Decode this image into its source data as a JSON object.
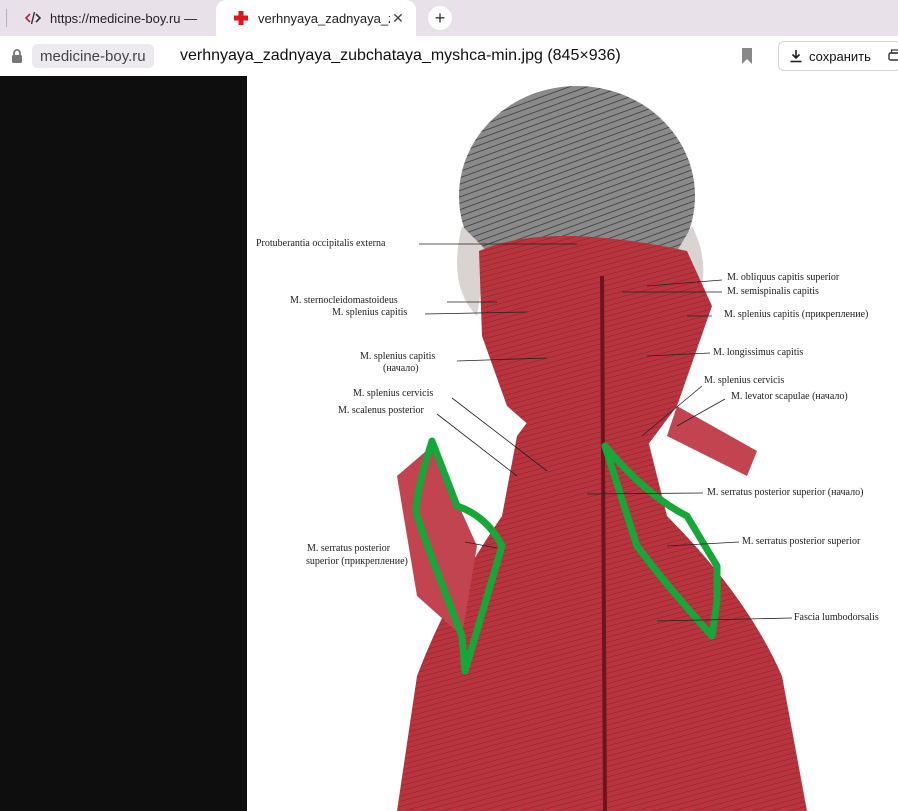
{
  "tabs": [
    {
      "title": "https://medicine-boy.ru —",
      "active": false,
      "favicon": "code-icon"
    },
    {
      "title": "verhnyaya_zadnyaya_zu",
      "active": true,
      "favicon": "red-cross-icon"
    }
  ],
  "address": {
    "domain": "medicine-boy.ru",
    "page_title": "verhnyaya_zadnyaya_zubchataya_myshca-min.jpg (845×936)",
    "save_label": "сохранить"
  },
  "labels": {
    "protuberantia": "Protuberantia occipitalis externa",
    "scm": "M. sternocleidomastoideus",
    "splenius_capitis_l": "M. splenius capitis",
    "splenius_capitis_origin_1": "M. splenius capitis",
    "splenius_capitis_origin_2": "(начало)",
    "splenius_cervicis_l": "M. splenius cervicis",
    "scalenus": "M. scalenus posterior",
    "serratus_attach_1": "M. serratus posterior",
    "serratus_attach_2": "superior (прикрепление)",
    "obliquus": "M. obliquus capitis superior",
    "semispinalis": "M. semispinalis capitis",
    "splenius_capitis_attach": "M. splenius capitis (прикрепление)",
    "longissimus": "M. longissimus capitis",
    "splenius_cervicis_r": "M. splenius cervicis",
    "levator": "M. levator scapulae (начало)",
    "serratus_origin": "M. serratus posterior superior (начало)",
    "serratus_r": "M. serratus posterior superior",
    "fascia": "Fascia lumbodorsalis"
  },
  "colors": {
    "muscle": "#b8343f",
    "highlight": "#17a63a"
  }
}
